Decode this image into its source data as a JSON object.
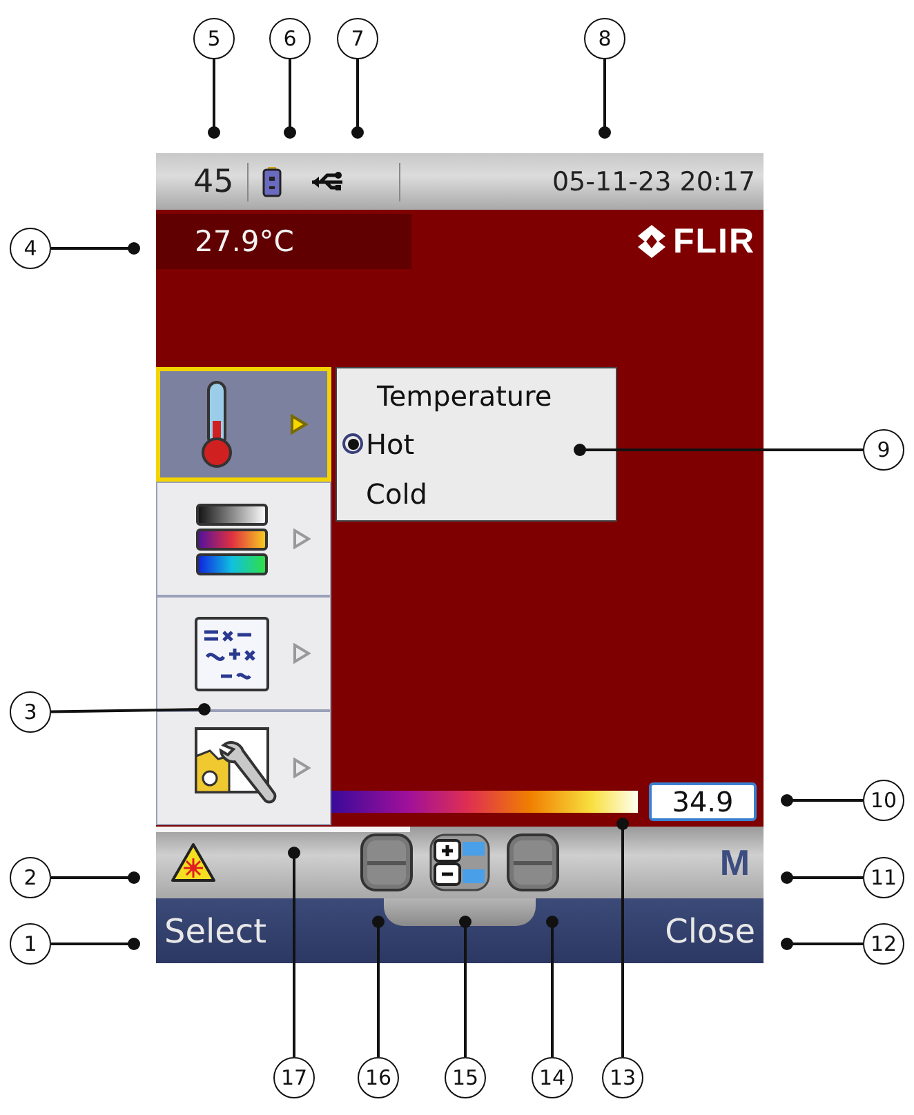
{
  "status_bar": {
    "count": "45",
    "datetime": "05-11-23 20:17"
  },
  "temperature": "27.9°C",
  "logo": "FLIR",
  "menu": [
    {
      "kind": "thermometer",
      "selected": true
    },
    {
      "kind": "palette",
      "selected": false
    },
    {
      "kind": "formula",
      "selected": false
    },
    {
      "kind": "settings",
      "selected": false
    }
  ],
  "submenu": {
    "title": "Temperature",
    "options": [
      {
        "label": "Hot",
        "selected": true
      },
      {
        "label": "Cold",
        "selected": false
      }
    ]
  },
  "scale": {
    "value": "34.9"
  },
  "mode": "M",
  "soft_keys": {
    "left": "Select",
    "right": "Close"
  },
  "callouts": [
    "5",
    "6",
    "7",
    "8",
    "4",
    "9",
    "3",
    "10",
    "2",
    "11",
    "1",
    "12",
    "17",
    "16",
    "15",
    "14",
    "13"
  ]
}
